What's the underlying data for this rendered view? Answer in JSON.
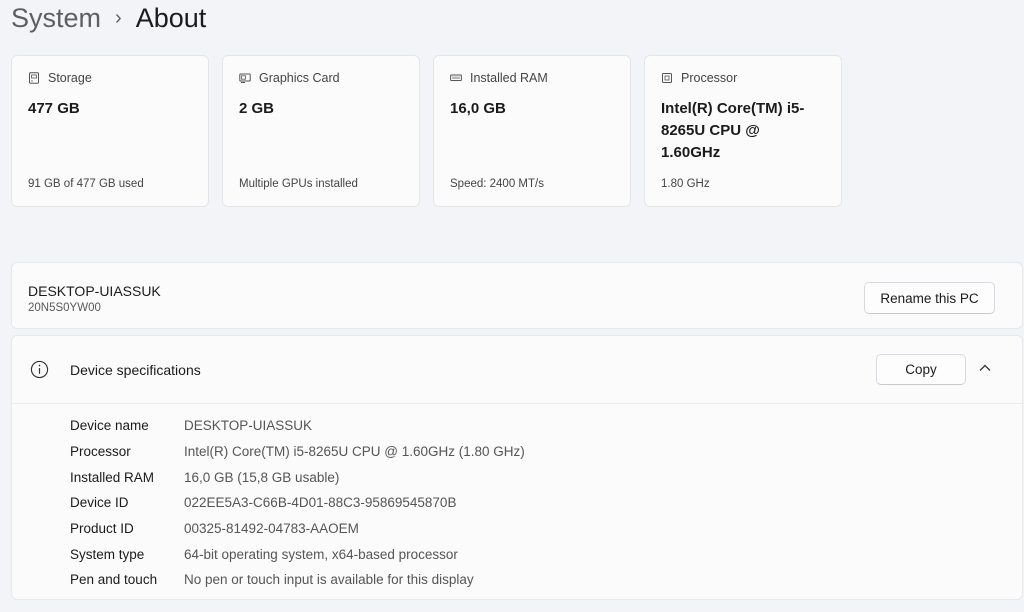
{
  "breadcrumb": {
    "parent": "System",
    "separator": "›",
    "current": "About"
  },
  "cards": [
    {
      "title": "Storage",
      "icon": "storage-icon",
      "value": "477 GB",
      "footer": "91 GB of 477 GB used"
    },
    {
      "title": "Graphics Card",
      "icon": "graphics-card-icon",
      "value": "2 GB",
      "footer": "Multiple GPUs installed"
    },
    {
      "title": "Installed RAM",
      "icon": "ram-icon",
      "value": "16,0 GB",
      "footer": "Speed: 2400 MT/s"
    },
    {
      "title": "Processor",
      "icon": "processor-icon",
      "value": "Intel(R) Core(TM) i5-8265U CPU @ 1.60GHz",
      "footer": "1.80 GHz"
    }
  ],
  "pc": {
    "name": "DESKTOP-UIASSUK",
    "model": "20N5S0YW00",
    "rename_label": "Rename this PC"
  },
  "specs": {
    "title": "Device specifications",
    "copy_label": "Copy",
    "rows": [
      {
        "label": "Device name",
        "value": "DESKTOP-UIASSUK"
      },
      {
        "label": "Processor",
        "value": "Intel(R) Core(TM) i5-8265U CPU @ 1.60GHz (1.80 GHz)"
      },
      {
        "label": "Installed RAM",
        "value": "16,0 GB (15,8 GB usable)"
      },
      {
        "label": "Device ID",
        "value": "022EE5A3-C66B-4D01-88C3-95869545870B"
      },
      {
        "label": "Product ID",
        "value": "00325-81492-04783-AAOEM"
      },
      {
        "label": "System type",
        "value": "64-bit operating system, x64-based processor"
      },
      {
        "label": "Pen and touch",
        "value": "No pen or touch input is available for this display"
      }
    ]
  }
}
